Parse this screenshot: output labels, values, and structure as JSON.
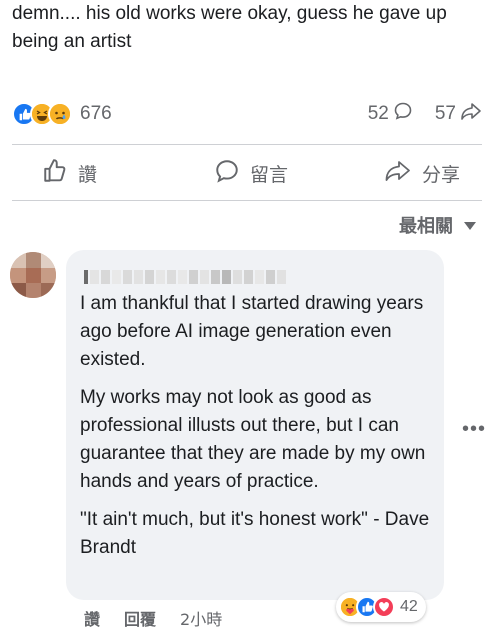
{
  "post": {
    "text": "demn.... his old works were okay, guess he gave up being an artist"
  },
  "reactions": {
    "count": "676",
    "comments_count": "52",
    "shares_count": "57",
    "icons": [
      "like-icon",
      "haha-icon",
      "sad-icon"
    ]
  },
  "actions": {
    "like_label": "讚",
    "comment_label": "留言",
    "share_label": "分享"
  },
  "sort": {
    "label": "最相關"
  },
  "comment": {
    "paragraph1": "I am thankful that I started drawing years ago before AI image generation even existed.",
    "paragraph2": "My works may not look as good as professional illusts out there, but I can guarantee that they are made by my own hands and years of practice.",
    "paragraph3": "\"It ain't much, but it's honest work\" - Dave Brandt",
    "like_label": "讚",
    "reply_label": "回覆",
    "time": "2小時",
    "reaction_count": "42",
    "reaction_icons": [
      "care-icon",
      "like-icon",
      "love-icon"
    ]
  },
  "colors": {
    "like_blue": "#1877f2",
    "love_red": "#f33e58",
    "emoji_yellow": "#f7b125",
    "bubble_bg": "#f0f2f5",
    "meta_gray": "#65676b"
  }
}
